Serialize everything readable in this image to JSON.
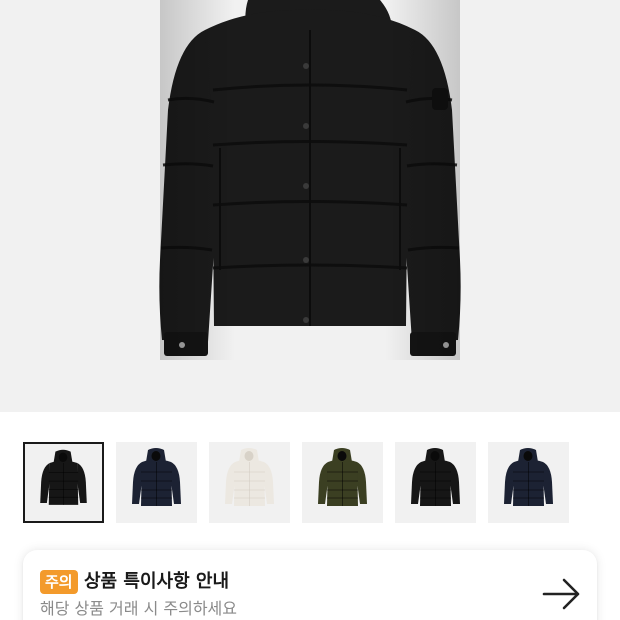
{
  "product_gallery": {
    "main_image": {
      "icon": "puffer-jacket-black",
      "color": "#1b1b1b"
    },
    "thumbnails": [
      {
        "icon": "puffer-jacket-black",
        "color": "#161616",
        "selected": true
      },
      {
        "icon": "puffer-jacket-navy",
        "color": "#1c2233",
        "selected": false
      },
      {
        "icon": "puffer-jacket-white",
        "color": "#ece8e1",
        "selected": false
      },
      {
        "icon": "puffer-jacket-olive",
        "color": "#3b3f22",
        "selected": false
      },
      {
        "icon": "puffer-jacket-black",
        "color": "#161616",
        "selected": false
      },
      {
        "icon": "puffer-jacket-navy",
        "color": "#1c2233",
        "selected": false
      }
    ]
  },
  "notice": {
    "badge": "주의",
    "badge_color": "#f39a2b",
    "title": "상품 특이사항 안내",
    "subtitle": "해당 상품 거래 시 주의하세요",
    "arrow_icon": "arrow-right-icon"
  }
}
